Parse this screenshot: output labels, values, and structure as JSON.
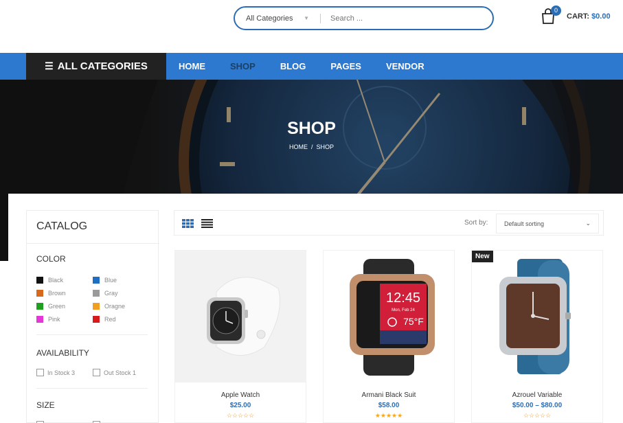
{
  "header": {
    "search_category": "All Categories",
    "search_placeholder": "Search ...",
    "cart_count": "0",
    "cart_label": "CART:",
    "cart_amount": "$0.00"
  },
  "nav": {
    "all_categories": "ALL CATEGORIES",
    "items": [
      "HOME",
      "SHOP",
      "BLOG",
      "PAGES",
      "VENDOR"
    ],
    "active": "SHOP"
  },
  "hero": {
    "title": "SHOP",
    "breadcrumb_home": "HOME",
    "breadcrumb_sep": "/",
    "breadcrumb_current": "SHOP"
  },
  "sidebar": {
    "title": "CATALOG",
    "color_heading": "COLOR",
    "colors": [
      {
        "label": "Black",
        "hex": "#111111"
      },
      {
        "label": "Blue",
        "hex": "#1e6fc4"
      },
      {
        "label": "Brown",
        "hex": "#d9691a"
      },
      {
        "label": "Gray",
        "hex": "#9a9a9a"
      },
      {
        "label": "Green",
        "hex": "#1fa021"
      },
      {
        "label": "Oragne",
        "hex": "#f0a020"
      },
      {
        "label": "Pink",
        "hex": "#e635d8"
      },
      {
        "label": "Red",
        "hex": "#d91a1a"
      }
    ],
    "availability_heading": "AVAILABILITY",
    "in_stock": "In Stock 3",
    "out_stock": "Out Stock 1",
    "size_heading": "SIZE"
  },
  "toolbar": {
    "sort_label": "Sort by:",
    "sort_value": "Default sorting"
  },
  "products": [
    {
      "name": "Apple Watch",
      "price": "$25.00",
      "rating": 0,
      "badge": ""
    },
    {
      "name": "Armani Black Suit",
      "price": "$58.00",
      "rating": 5,
      "badge": ""
    },
    {
      "name": "Azrouel Variable",
      "price": "$50.00 – $80.00",
      "rating": 0,
      "badge": "New"
    }
  ],
  "colors": {
    "accent": "#2c79cf",
    "dark": "#222222",
    "price": "#2a6db5"
  }
}
